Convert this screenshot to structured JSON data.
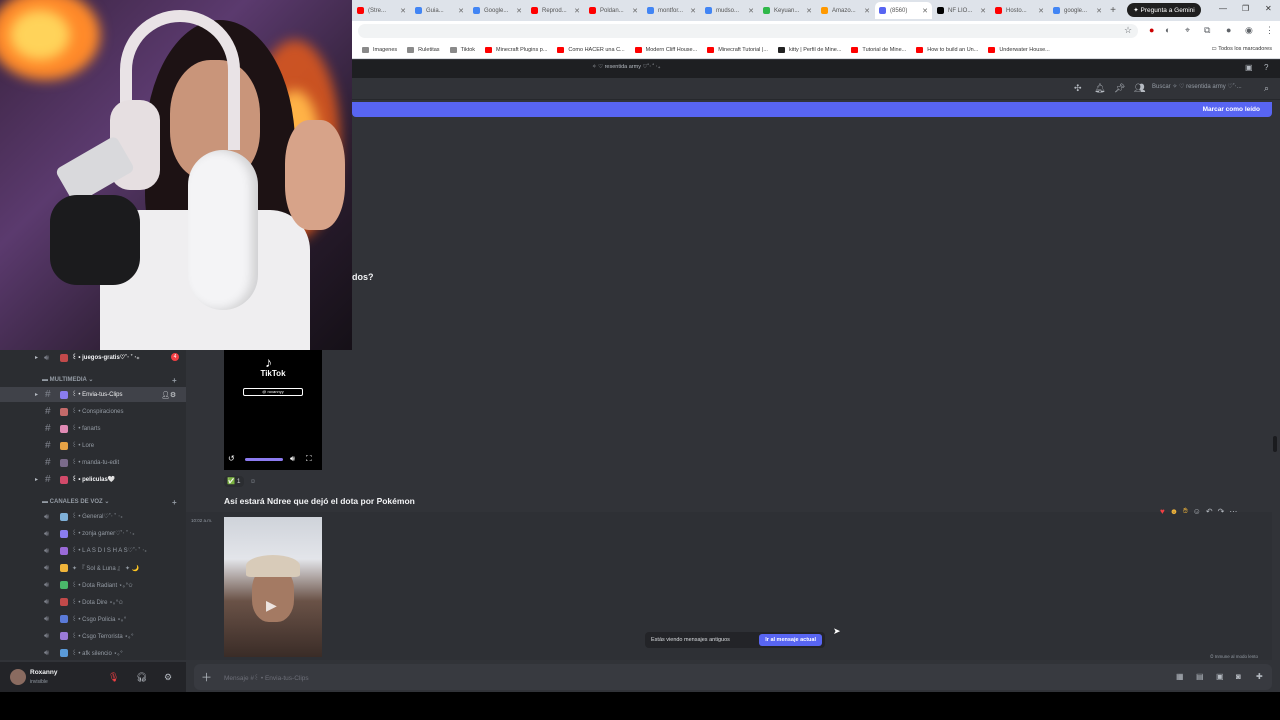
{
  "browser": {
    "tabs": [
      {
        "label": "(Stre...",
        "color": "#ff0000"
      },
      {
        "label": "Guia...",
        "color": "#4285f4"
      },
      {
        "label": "Google...",
        "color": "#4285f4"
      },
      {
        "label": "Reprod...",
        "color": "#ff0000"
      },
      {
        "label": "Poldan...",
        "color": "#ff0000"
      },
      {
        "label": "montfor...",
        "color": "#4285f4"
      },
      {
        "label": "mudso...",
        "color": "#4285f4"
      },
      {
        "label": "Keyuan...",
        "color": "#2fb84a"
      },
      {
        "label": "Amazo...",
        "color": "#ff9900"
      },
      {
        "label": "(8560)",
        "color": "#5865f2"
      },
      {
        "label": "NF LIO...",
        "color": "#000000"
      },
      {
        "label": "Hosto...",
        "color": "#ff0000"
      },
      {
        "label": "google...",
        "color": "#4285f4"
      }
    ],
    "gemini_label": "Pregunta a Gemini",
    "bookmarks": [
      {
        "label": "Imagenes",
        "color": "#8a8a8a"
      },
      {
        "label": "Ruletitas",
        "color": "#8a8a8a"
      },
      {
        "label": "Tiktok",
        "color": "#8a8a8a"
      },
      {
        "label": "Minecraft Plugins p...",
        "color": "#ff0000"
      },
      {
        "label": "Como HACER una C...",
        "color": "#ff0000"
      },
      {
        "label": "Modern Cliff House...",
        "color": "#ff0000"
      },
      {
        "label": "Minecraft Tutorial |...",
        "color": "#ff0000"
      },
      {
        "label": "kitty | Perfil de Mine...",
        "color": "#222222"
      },
      {
        "label": "Tutorial de Mine...",
        "color": "#ff0000"
      },
      {
        "label": "How to build an Un...",
        "color": "#ff0000"
      },
      {
        "label": "Underwater House...",
        "color": "#ff0000"
      }
    ],
    "all_bookmarks": "Todos los marcadores"
  },
  "discord": {
    "server_title": "✧ ♡ resentida army ♡˚‧ ˚ ‧₊",
    "search_placeholder": "Buscar ✧ ♡ resentida army ♡˚‧...",
    "mark_read": "Marcar como leído",
    "cut_text": "dos?",
    "sidebar": {
      "channels_top": [
        {
          "name": "꒰ • juegos-gratis♡˚‧ ˚ ‧₊",
          "color": "#c14a4a",
          "bold": true
        }
      ],
      "badge": "4",
      "cat_multimedia": "MULTIMEDIA",
      "text_channels": [
        {
          "name": "꒰ • Envia-tus-Clips",
          "color": "#8a7df0",
          "selected": true
        },
        {
          "name": "꒰ • Conspiraciones",
          "color": "#c46a6a"
        },
        {
          "name": "꒰ • fanarts",
          "color": "#e08ab4"
        },
        {
          "name": "꒰ • Lore",
          "color": "#e6a245"
        },
        {
          "name": "꒰ • manda-tu-edit",
          "color": "#7a6a8a"
        },
        {
          "name": "꒰ • peliculas🤍",
          "color": "#d24a6a",
          "bold": true
        }
      ],
      "cat_voz": "CANALES DE VOZ",
      "voice_channels": [
        {
          "name": "꒰ • General♡˚‧ ˚ ‧₊",
          "color": "#7fb0d8"
        },
        {
          "name": "꒰ • zonja gamer♡˚‧ ˚ ‧₊",
          "color": "#8a7df0"
        },
        {
          "name": "꒰ • L A S D I S H A S♡˚‧ ˚ ‧₊",
          "color": "#9a6ad8"
        },
        {
          "name": "✦ 『 Sol & Luna 』 ✦ 🌙",
          "color": "#f0b43a"
        },
        {
          "name": "꒰ • Dota Radiant ⋆｡°✩",
          "color": "#4ab86a"
        },
        {
          "name": "꒰ • Dota Dire ⋆｡°✩",
          "color": "#c14a4a"
        },
        {
          "name": "꒰ • Csgo Policia ⋆｡°",
          "color": "#5a7ad8"
        },
        {
          "name": "꒰ • Csgo Terrorista ⋆｡°",
          "color": "#9a7ad8"
        },
        {
          "name": "꒰ • afk silencio ⋆｡°",
          "color": "#5a9ad8"
        }
      ]
    },
    "user": {
      "name": "Roxanny",
      "status": "invisible"
    },
    "tiktok": {
      "brand": "TikTok",
      "handle": "@ roxannyy"
    },
    "reaction": {
      "emoji": "✅",
      "count": "1"
    },
    "message": {
      "title": "Así estará Ndree que dejó el dota por Pokémon",
      "timestamp": "10:02 a.m."
    },
    "old_messages": "Estás viendo mensajes antiguos",
    "jump_btn": "Ir al mensaje actual",
    "slowmode": "Inmune al modo lento",
    "composer_placeholder": "Mensaje #꒰ • Envia-tus-Clips"
  }
}
